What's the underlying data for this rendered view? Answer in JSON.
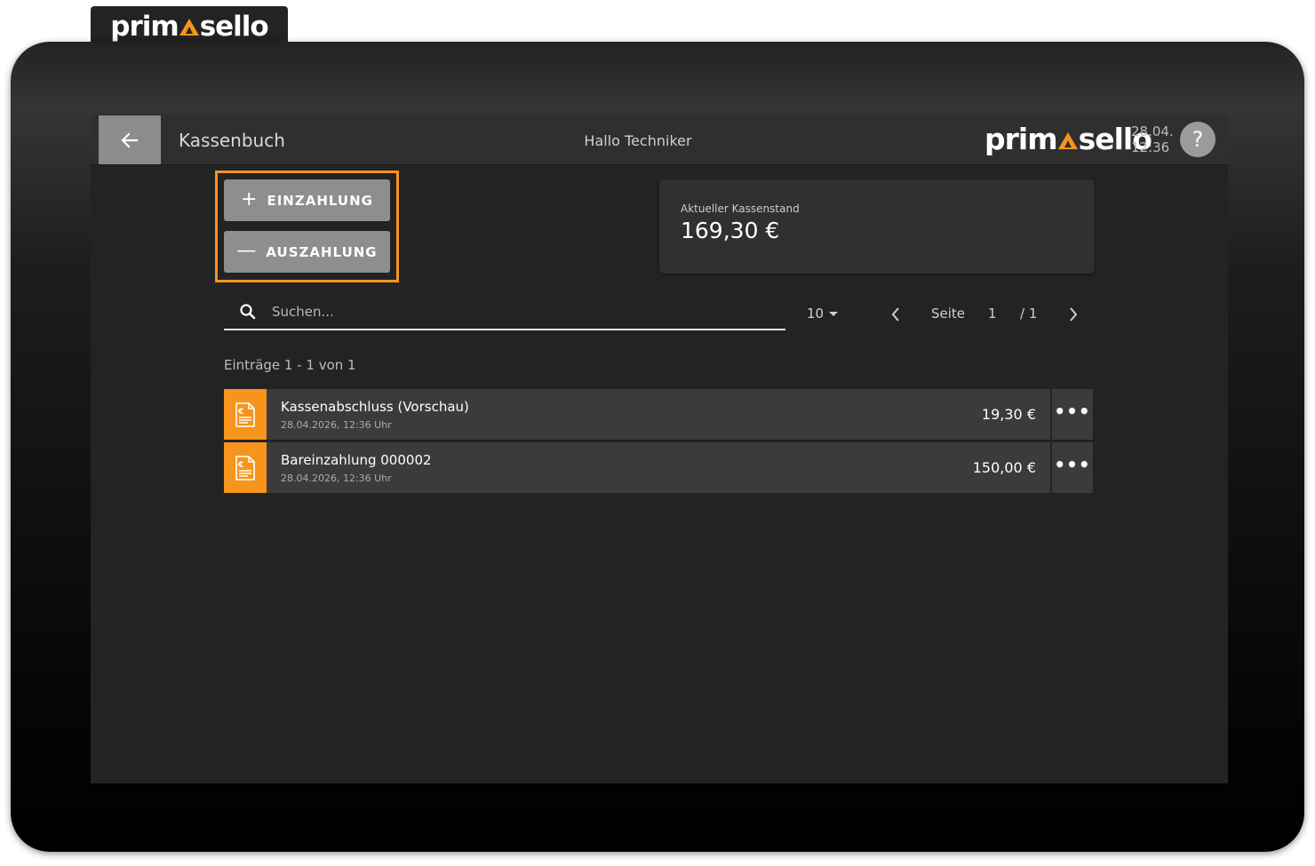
{
  "brand": {
    "logo_left": "prim",
    "logo_right": "sello",
    "accent_color": "#f7941d"
  },
  "header": {
    "back_icon": "arrow-left-icon",
    "title": "Kassenbuch",
    "greeting": "Hallo Techniker",
    "date": "28.04.",
    "time": "12:36",
    "help_label": "?"
  },
  "actions": {
    "deposit_label": "EINZAHLUNG",
    "deposit_glyph": "+",
    "withdraw_label": "AUSZAHLUNG",
    "withdraw_glyph": "—"
  },
  "balance": {
    "label": "Aktueller Kassenstand",
    "value": "169,30 €"
  },
  "search": {
    "placeholder": "Suchen...",
    "value": ""
  },
  "pagination": {
    "per_page": "10",
    "page_label": "Seite",
    "current_page": "1",
    "total_pages": "/ 1"
  },
  "entries_count": "Einträge 1 - 1 von 1",
  "entries": [
    {
      "title": "Kassenabschluss (Vorschau)",
      "date": "28.04.2026, 12:36 Uhr",
      "amount": "19,30 €",
      "more": "•••"
    },
    {
      "title": "Bareinzahlung 000002",
      "date": "28.04.2026, 12:36 Uhr",
      "amount": "150,00 €",
      "more": "•••"
    }
  ]
}
